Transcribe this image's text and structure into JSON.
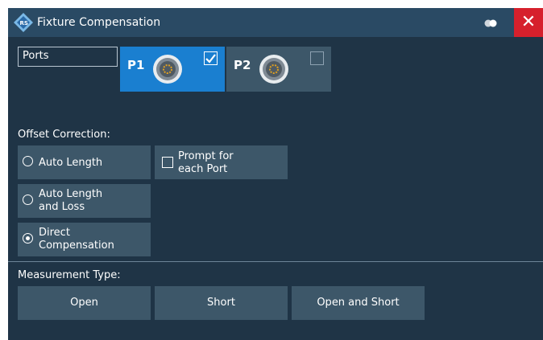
{
  "window": {
    "title": "Fixture Compensation",
    "close_label": "✕"
  },
  "ports": {
    "label": "Ports",
    "items": [
      {
        "label": "P1",
        "checked": true
      },
      {
        "label": "P2",
        "checked": false
      }
    ]
  },
  "offset_correction": {
    "label": "Offset Correction:",
    "auto_length": {
      "line1": "Auto Length",
      "selected": false
    },
    "auto_length_loss": {
      "line1": "Auto Length",
      "line2": "and Loss",
      "selected": false
    },
    "direct_comp": {
      "line1": "Direct",
      "line2": "Compensation",
      "selected": true
    },
    "prompt": {
      "line1": "Prompt for",
      "line2": "each Port",
      "checked": false
    }
  },
  "measurement_type": {
    "label": "Measurement Type:",
    "buttons": [
      "Open",
      "Short",
      "Open and Short"
    ]
  },
  "colors": {
    "background": "#1f3446",
    "titlebar": "#2a4a64",
    "selected_port": "#1a7fd0",
    "button": "#3d5769",
    "close": "#d6202c",
    "connector_gold": "#e0a020"
  }
}
